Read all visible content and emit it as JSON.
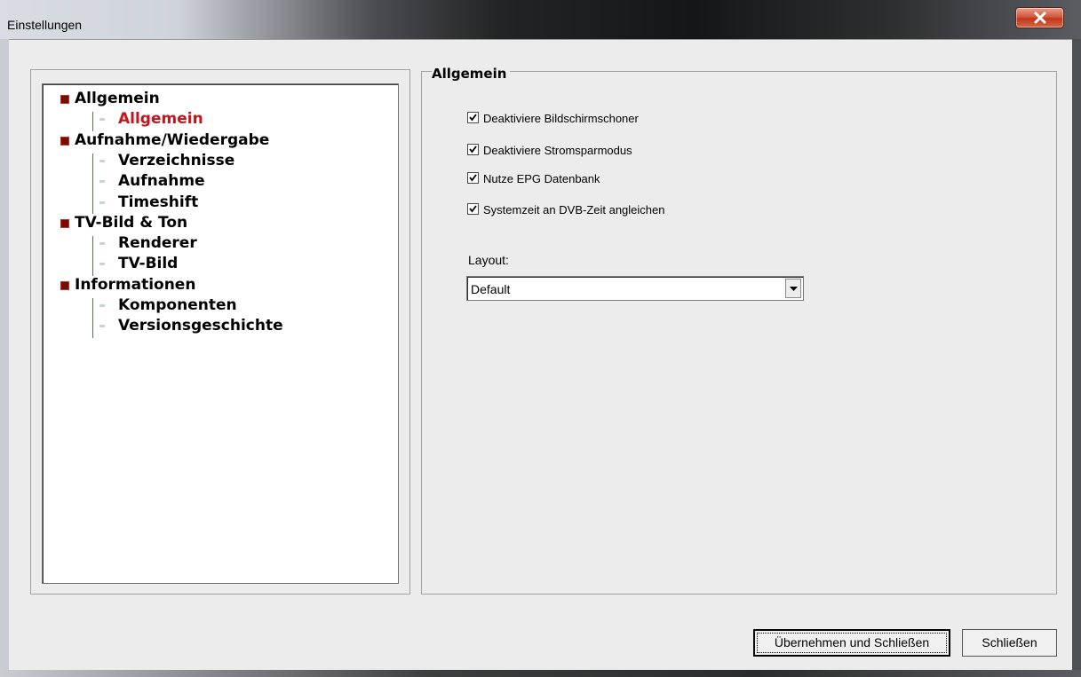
{
  "window": {
    "title": "Einstellungen",
    "close_icon": "close-icon"
  },
  "tree": {
    "items": [
      {
        "label": "Allgemein",
        "level": 0,
        "selected": false
      },
      {
        "label": "Allgemein",
        "level": 1,
        "selected": true
      },
      {
        "label": "Aufnahme/Wiedergabe",
        "level": 0,
        "selected": false
      },
      {
        "label": "Verzeichnisse",
        "level": 1,
        "selected": false
      },
      {
        "label": "Aufnahme",
        "level": 1,
        "selected": false
      },
      {
        "label": "Timeshift",
        "level": 1,
        "selected": false
      },
      {
        "label": "TV-Bild & Ton",
        "level": 0,
        "selected": false
      },
      {
        "label": "Renderer",
        "level": 1,
        "selected": false
      },
      {
        "label": "TV-Bild",
        "level": 1,
        "selected": false
      },
      {
        "label": "Informationen",
        "level": 0,
        "selected": false
      },
      {
        "label": "Komponenten",
        "level": 1,
        "selected": false
      },
      {
        "label": "Versionsgeschichte",
        "level": 1,
        "selected": false
      }
    ],
    "selected_color": "#c4151c"
  },
  "panel": {
    "title": "Allgemein",
    "checkboxes": [
      {
        "label": "Deaktiviere Bildschirmschoner",
        "checked": true
      },
      {
        "label": "Deaktiviere Stromsparmodus",
        "checked": true
      },
      {
        "label": "Nutze EPG Datenbank",
        "checked": true
      },
      {
        "label": "Systemzeit an DVB-Zeit angleichen",
        "checked": true
      }
    ],
    "layout_label": "Layout:",
    "layout_value": "Default"
  },
  "buttons": {
    "apply_close": "Übernehmen und Schließen",
    "close": "Schließen"
  }
}
